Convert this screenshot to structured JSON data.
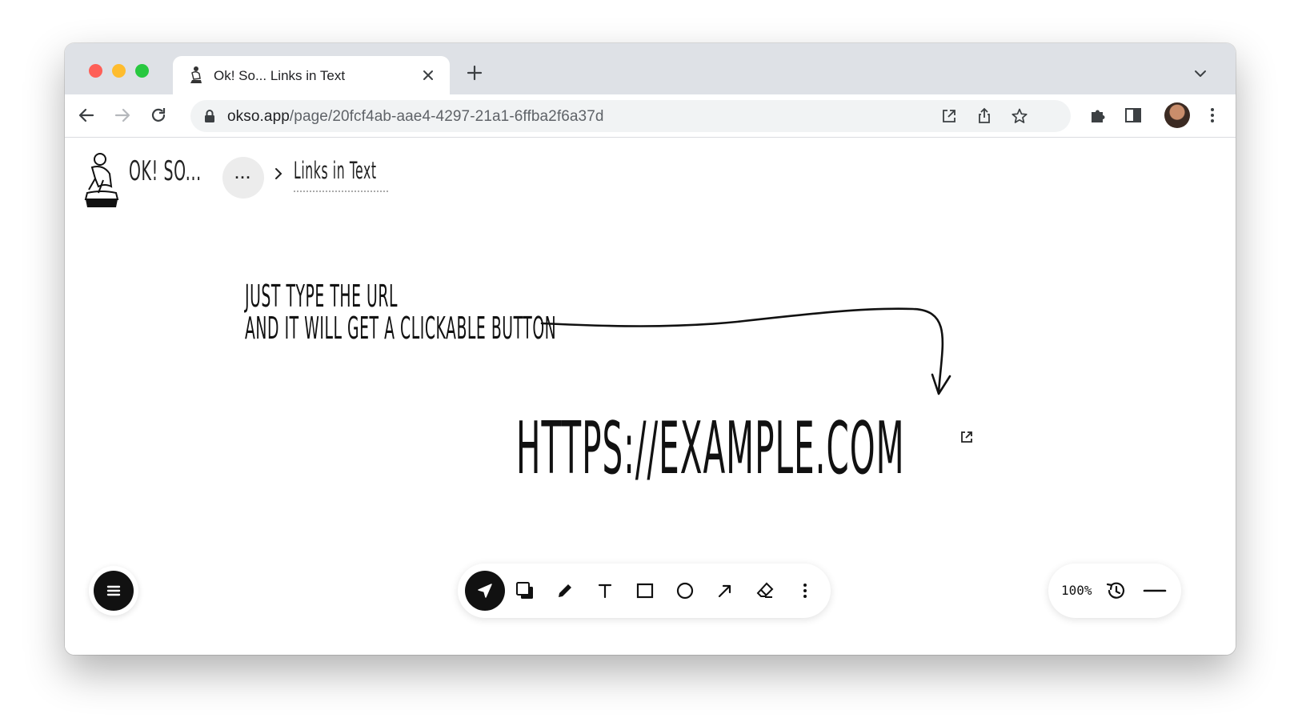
{
  "browser": {
    "tab_title": "Ok! So... Links in Text",
    "url_domain": "okso.app",
    "url_path": "/page/20fcf4ab-aae4-4297-21a1-6ffba2f6a37d"
  },
  "app": {
    "logo_text": "OK! SO...",
    "more_label": "···",
    "breadcrumb_title": "Links in Text"
  },
  "canvas": {
    "note_line1": "JUST TYPE THE URL",
    "note_line2": "AND IT WILL GET A CLICKABLE BUTTON",
    "link_text": "HTTPS://EXAMPLE.COM"
  },
  "toolbar": {
    "tools": [
      "select-tool",
      "layers-tool",
      "pencil-tool",
      "text-tool",
      "rectangle-tool",
      "ellipse-tool",
      "arrow-tool",
      "eraser-tool",
      "more-tool"
    ],
    "active_tool": "select-tool"
  },
  "zoom": {
    "level": "100%"
  },
  "colors": {
    "tabstrip": "#dee1e6",
    "omnibox": "#f1f3f4",
    "ink": "#111111",
    "accent_red": "#fe5f57",
    "accent_yellow": "#febc2e",
    "accent_green": "#28c840"
  }
}
